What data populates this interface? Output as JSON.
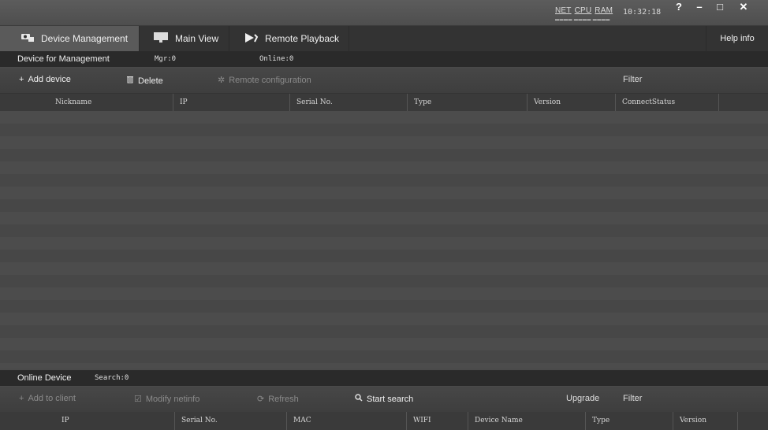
{
  "system": {
    "monitor_labels": [
      "NET",
      "CPU",
      "RAM"
    ],
    "clock": "10:32:18"
  },
  "window_controls": {
    "help": "?",
    "minimize": "–",
    "maximize": "□",
    "close": "✕"
  },
  "tabs": [
    {
      "label": "Device Management",
      "icon": "device-management-icon",
      "active": true
    },
    {
      "label": "Main View",
      "icon": "monitor-icon",
      "active": false
    },
    {
      "label": "Remote Playback",
      "icon": "playback-icon",
      "active": false
    }
  ],
  "help_info": "Help info",
  "managed": {
    "title": "Device for Management",
    "mgr": "Mgr:0",
    "online": "Online:0",
    "toolbar": {
      "add": "Add device",
      "delete": "Delete",
      "remote_config": "Remote configuration",
      "filter": "Filter"
    },
    "columns": [
      "Nickname",
      "IP",
      "Serial No.",
      "Type",
      "Version",
      "ConnectStatus"
    ]
  },
  "online": {
    "title": "Online Device",
    "search": "Search:0",
    "toolbar": {
      "add_to_client": "Add to client",
      "modify_netinfo": "Modify netinfo",
      "refresh": "Refresh",
      "start_search": "Start search",
      "upgrade": "Upgrade",
      "filter": "Filter"
    },
    "columns": [
      "IP",
      "Serial No.",
      "MAC",
      "WIFI",
      "Device Name",
      "Type",
      "Version"
    ]
  },
  "colors": {
    "background": "#4a4a4a",
    "tab_active": "#5a5a5a",
    "bar_dark": "#2a2a2a"
  }
}
